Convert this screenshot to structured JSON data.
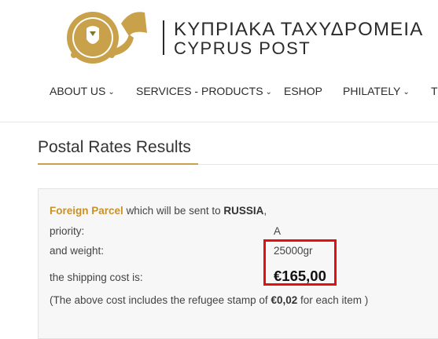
{
  "brand": {
    "name_greek": "ΚΥΠΡΙΑΚΑ ΤΑΧΥΔΡΟΜΕΙΑ",
    "name_english": "CYPRUS POST",
    "colors": {
      "gold": "#c8a14a",
      "dark": "#2b2b2b",
      "highlight": "#e31010"
    }
  },
  "nav": {
    "items": [
      {
        "label": "ABOUT US",
        "dropdown": true
      },
      {
        "label": "SERVICES - PRODUCTS",
        "dropdown": true
      },
      {
        "label": "ESHOP",
        "dropdown": false
      },
      {
        "label": "PHILATELY",
        "dropdown": true
      },
      {
        "label": "T",
        "dropdown": false
      }
    ]
  },
  "page": {
    "title": "Postal Rates Results"
  },
  "result": {
    "service": "Foreign Parcel",
    "sent_text": "which will be sent to",
    "country": "RUSSIA",
    "sent_suffix": ",",
    "priority_label": "priority:",
    "priority_value": "A",
    "weight_label": "and weight:",
    "weight_value": "25000gr",
    "cost_label": "the shipping cost is:",
    "cost_value": "€165,00",
    "note_prefix": "(The above cost includes the refugee stamp of",
    "note_amount": "€0,02",
    "note_suffix": "for each item )"
  }
}
